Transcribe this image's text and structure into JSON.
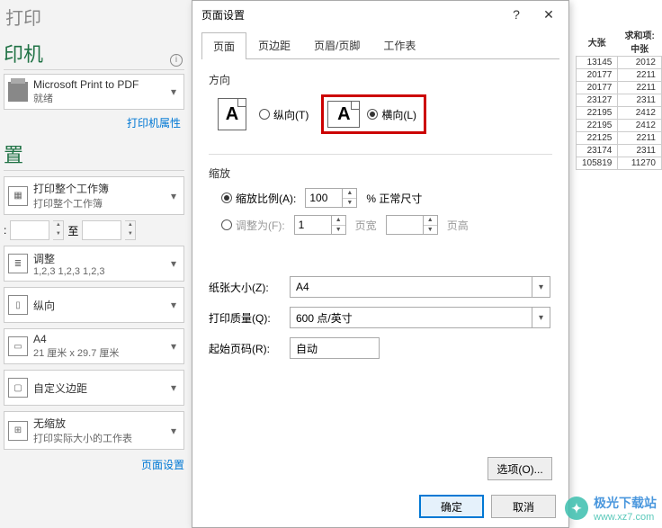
{
  "left": {
    "print_label": "打印",
    "printer_section": "印机",
    "printer_name": "Microsoft Print to PDF",
    "printer_status": "就绪",
    "printer_props": "打印机属性",
    "settings_section": "置",
    "print_scope": {
      "title": "打印整个工作簿",
      "sub": "打印整个工作簿"
    },
    "pages_label": ":",
    "to_label": "至",
    "collate": {
      "title": "调整",
      "sub": "1,2,3    1,2,3    1,2,3"
    },
    "orientation": {
      "title": "纵向"
    },
    "paper": {
      "title": "A4",
      "sub": "21 厘米 x 29.7 厘米"
    },
    "margins": {
      "title": "自定义边距"
    },
    "scaling": {
      "title": "无缩放",
      "sub": "打印实际大小的工作表"
    },
    "page_setup_link": "页面设置"
  },
  "dialog": {
    "title": "页面设置",
    "tabs": [
      "页面",
      "页边距",
      "页眉/页脚",
      "工作表"
    ],
    "orientation_label": "方向",
    "portrait": "纵向(T)",
    "landscape": "横向(L)",
    "scaling_label": "缩放",
    "adjust_to": "缩放比例(A):",
    "adjust_value": "100",
    "normal_size": "% 正常尺寸",
    "fit_to": "调整为(F):",
    "fit_w": "1",
    "fit_w_label": "页宽",
    "fit_h": "",
    "fit_h_label": "页高",
    "paper_size_label": "纸张大小(Z):",
    "paper_size_value": "A4",
    "print_quality_label": "打印质量(Q):",
    "print_quality_value": "600 点/英寸",
    "first_page_label": "起始页码(R):",
    "first_page_value": "自动",
    "options_btn": "选项(O)...",
    "ok": "确定",
    "cancel": "取消"
  },
  "sheet": {
    "h1": "大张",
    "h2": "求和项:中张",
    "rows": [
      [
        "13145",
        "2012"
      ],
      [
        "20177",
        "2211"
      ],
      [
        "20177",
        "2211"
      ],
      [
        "23127",
        "2311"
      ],
      [
        "22195",
        "2412"
      ],
      [
        "22195",
        "2412"
      ],
      [
        "22125",
        "2211"
      ],
      [
        "23174",
        "2311"
      ],
      [
        "105819",
        "11270"
      ]
    ]
  },
  "watermark": {
    "name": "极光下载站",
    "url": "www.xz7.com"
  }
}
